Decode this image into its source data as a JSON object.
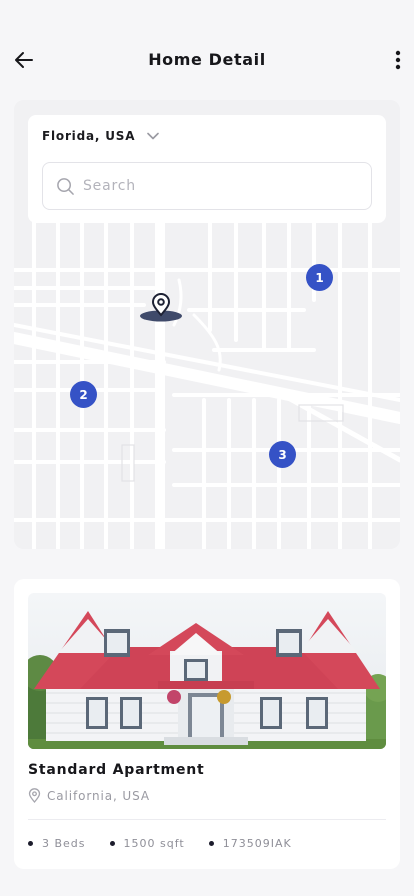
{
  "header": {
    "title": "Home Detail",
    "back_icon": "arrow-left-icon",
    "more_icon": "vertical-dots-icon"
  },
  "map": {
    "location": "Florida, USA",
    "search_placeholder": "Search",
    "markers": [
      "1",
      "2",
      "3"
    ],
    "marker_color": "#3552c6"
  },
  "listing": {
    "name": "Standard Apartment",
    "location": "California, USA",
    "specs": [
      "3 Beds",
      "1500 sqft",
      "173509IAK"
    ]
  }
}
